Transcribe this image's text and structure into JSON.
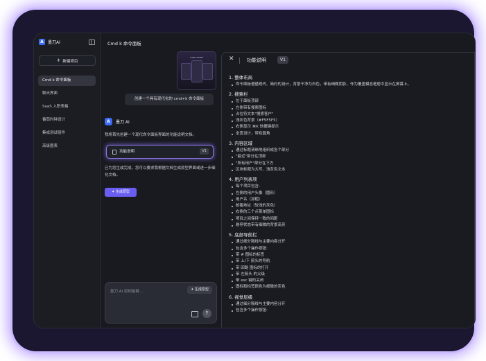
{
  "app": {
    "logo_mark": "A",
    "name": "墨刀AI"
  },
  "sidebar": {
    "new_button": "新建项目",
    "items": [
      {
        "label": "Cmd k 命令面板"
      },
      {
        "label": "聊天界面"
      },
      {
        "label": "SaaS 入职表格"
      },
      {
        "label": "番茄时钟设计"
      },
      {
        "label": "集成测试组件"
      },
      {
        "label": "高级图表"
      }
    ]
  },
  "header": {
    "title": "Cmd k 命令面板"
  },
  "thumbnail": {
    "title": "CARD MODE"
  },
  "chat": {
    "user_message": "创建一个具有现代化的 cmd+k 命令面板",
    "ai_name": "墨刀 AI",
    "ai_text1": "我将首先创建一个现代命令面板界面的功能说明文档。",
    "doc_card": {
      "label": "功能说明",
      "version": "V1"
    },
    "ai_text2": "已为您生成完成，您可以要求我根据文档生成原型界面或进一步细化文档。",
    "generate_button": "生成原型",
    "composer": {
      "placeholder": "墨刀 AI 如何能够…",
      "type_button": "生成原型"
    }
  },
  "panel": {
    "title": "功能说明",
    "version": "V1",
    "sections": [
      {
        "title": "1. 整体布局",
        "bullets": [
          "命令面板遵循现代、简约的设计，背景干净为白色，带有细微阴影，作为覆盖模态框居中显示在屏幕上。"
        ]
      },
      {
        "title": "2. 搜索栏",
        "bullets": [
          "位于面板顶部",
          "左侧带有搜索图标",
          "占位符文本\"搜索客户\"",
          "浅灰色背景（#F5F5F5）",
          "右侧显示 ⌘K 快捷键提示",
          "全宽设计，带有圆角"
        ]
      },
      {
        "title": "3. 内容区域",
        "bullets": [
          "通过标题清晰地组织成各个部分",
          "\"最近\"部分在顶部",
          "\"所有用户\"部分在下方",
          "区块标题为大写、浅灰色文本"
        ]
      },
      {
        "title": "4. 用户列表项",
        "bullets": [
          "每个项目包含:",
          "左侧的用户头像（圆形）",
          "用户名（加粗）",
          "邮箱地址（较浅的灰色）",
          "右侧的三个点菜单图标",
          "项目之间保持一致的间距",
          "悬停状态带有细微的背景高亮"
        ]
      },
      {
        "title": "5. 底部导航栏",
        "bullets": [
          "通过细分隔线与主要内容分开",
          "包含多个操作按钮:",
          "带 # 图标的标签",
          "带 上/下 箭头的导航",
          "带 回路 图标的打开",
          "带 左箭头 的父级",
          "带 esc 键的关闭",
          "图标和标签颜色为细微的灰色"
        ]
      },
      {
        "title": "6. 视觉层级",
        "bullets": [
          "通过细分隔线与主要内容分开",
          "包含多个操作按钮:"
        ]
      }
    ]
  }
}
